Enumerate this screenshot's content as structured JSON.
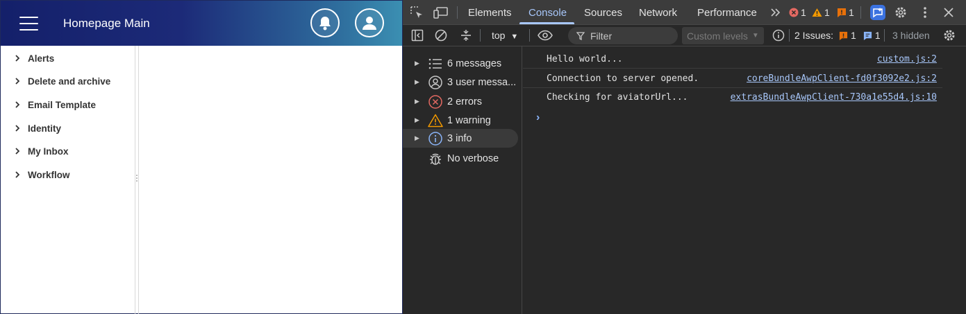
{
  "app": {
    "title": "Homepage Main",
    "sidebar": [
      {
        "label": "Alerts"
      },
      {
        "label": "Delete and archive"
      },
      {
        "label": "Email Template"
      },
      {
        "label": "Identity"
      },
      {
        "label": "My Inbox"
      },
      {
        "label": "Workflow"
      }
    ]
  },
  "devtools": {
    "tabs": [
      {
        "label": "Elements"
      },
      {
        "label": "Console"
      },
      {
        "label": "Sources"
      },
      {
        "label": "Network"
      },
      {
        "label": "Performance"
      }
    ],
    "active_tab": "Console",
    "counts": {
      "errors": "1",
      "warnings": "1",
      "issues": "1"
    },
    "toolbar": {
      "context": "top",
      "filter_placeholder": "Filter",
      "levels": "Custom levels",
      "issues_label": "2 Issues:",
      "issues_warn": "1",
      "issues_info": "1",
      "hidden": "3 hidden"
    },
    "sidebar": [
      {
        "label": "6 messages",
        "icon": "list-icon"
      },
      {
        "label": "3 user messa...",
        "icon": "user-icon"
      },
      {
        "label": "2 errors",
        "icon": "error-icon"
      },
      {
        "label": "1 warning",
        "icon": "warning-icon"
      },
      {
        "label": "3 info",
        "icon": "info-icon"
      },
      {
        "label": "No verbose",
        "icon": "bug-icon"
      }
    ],
    "logs": [
      {
        "message": "Hello world...",
        "source": "custom.js:2"
      },
      {
        "message": "Connection to server opened.",
        "source": "coreBundleAwpClient-fd0f3092e2.js:2"
      },
      {
        "message": "Checking for aviatorUrl...",
        "source": "extrasBundleAwpClient-730a1e55d4.js:10"
      }
    ],
    "colors": {
      "accent": "#a8c7fa",
      "error": "#e46962",
      "warning": "#f29900",
      "issue": "#e8710a",
      "info": "#8ab4f8"
    }
  }
}
